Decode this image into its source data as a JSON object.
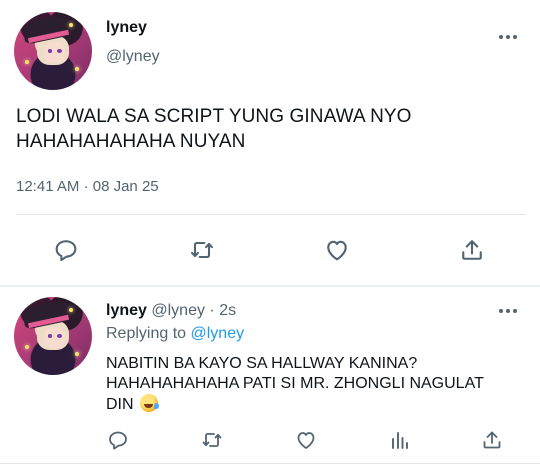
{
  "tweet": {
    "display_name": "lyney",
    "handle": "@lyney",
    "text_line1": "LODI WALA SA SCRIPT YUNG GINAWA NYO",
    "text_line2": "HAHAHAHAHAHA NUYAN",
    "time": "12:41 AM",
    "separator": "·",
    "date": "08 Jan 25",
    "icons": [
      "more-icon",
      "reply-icon",
      "retweet-icon",
      "like-icon",
      "share-icon"
    ]
  },
  "reply": {
    "display_name": "lyney",
    "handle": "@lyney",
    "dot": "·",
    "age": "2s",
    "replying_prefix": "Replying to",
    "replying_to": "@lyney",
    "text_line1": "NABITIN BA KAYO SA HALLWAY KANINA?",
    "text_line2": "HAHAHAHAHAHA PATI SI MR. ZHONGLI NAGULAT",
    "text_line3": "DIN",
    "emoji": "rolling-on-floor-laughing-emoji",
    "icons": [
      "more-icon",
      "reply-icon",
      "retweet-icon",
      "like-icon",
      "analytics-icon",
      "share-icon"
    ]
  },
  "colors": {
    "text": "#0f1419",
    "secondary": "#536471",
    "link": "#1d9bf0",
    "divider": "#e1e6ea"
  }
}
